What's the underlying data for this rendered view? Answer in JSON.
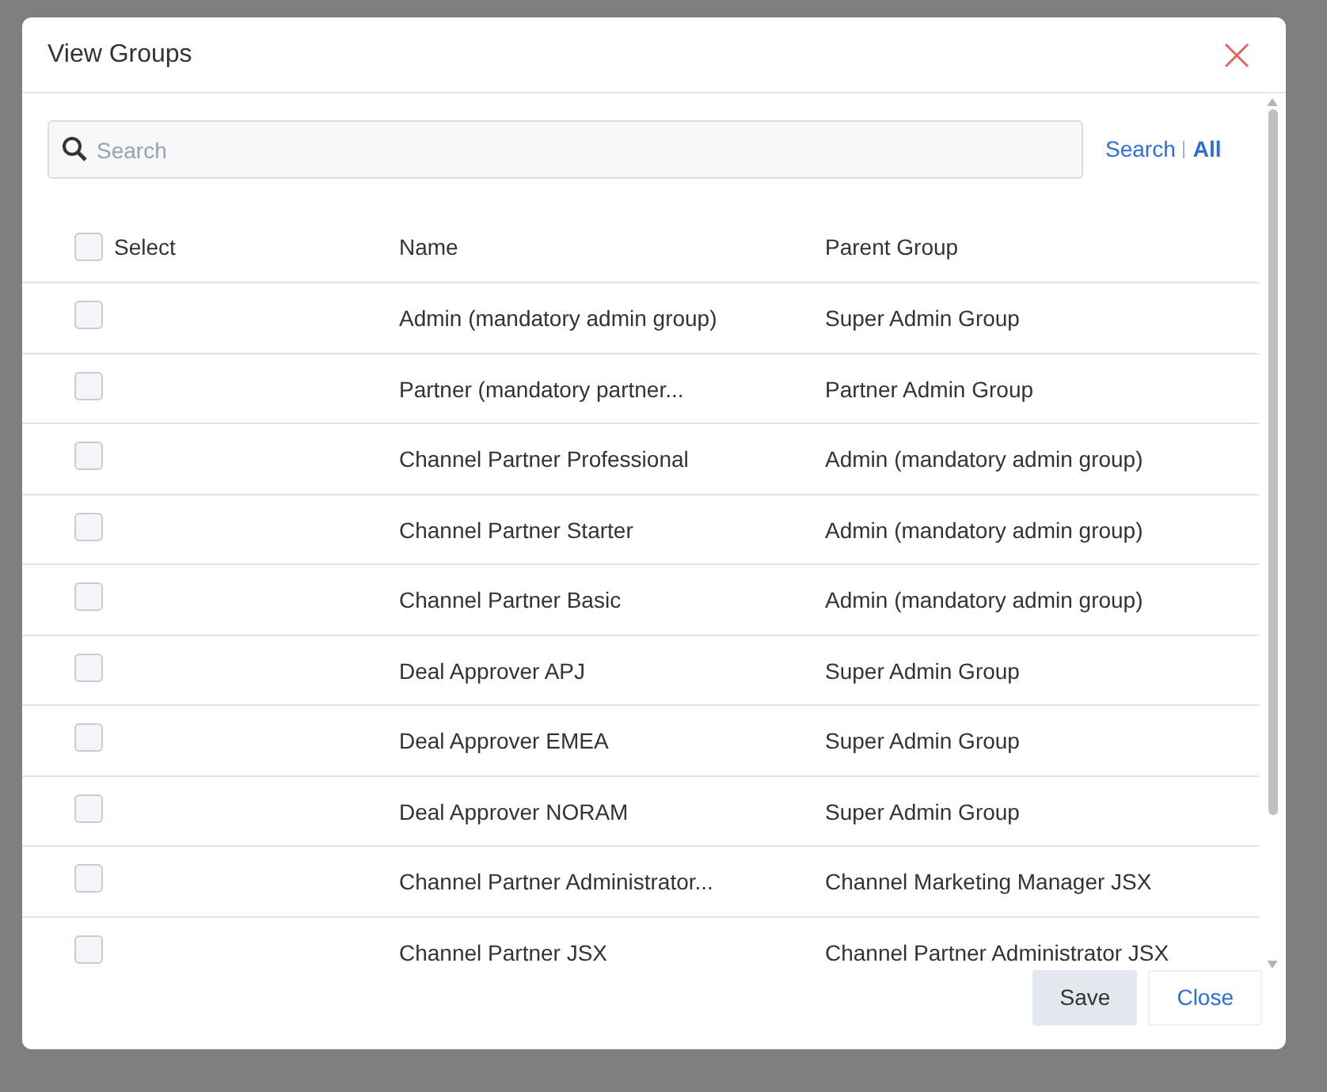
{
  "dialog": {
    "title": "View Groups"
  },
  "search": {
    "placeholder": "Search",
    "links": [
      "Search",
      "All"
    ]
  },
  "table": {
    "select_all": {
      "label": "Select",
      "checked": false
    },
    "columns": [
      "Name",
      "Parent Group"
    ],
    "rows": [
      {
        "name": "Admin (mandatory admin group)",
        "parent_group": "Super Admin Group",
        "checked": false
      },
      {
        "name": "Partner (mandatory partner...",
        "parent_group": "Partner Admin Group",
        "checked": false
      },
      {
        "name": "Channel Partner Professional",
        "parent_group": "Admin (mandatory admin group)",
        "checked": false
      },
      {
        "name": "Channel Partner Starter",
        "parent_group": "Admin (mandatory admin group)",
        "checked": false
      },
      {
        "name": "Channel Partner Basic",
        "parent_group": "Admin (mandatory admin group)",
        "checked": false
      },
      {
        "name": "Deal Approver APJ",
        "parent_group": "Super Admin Group",
        "checked": false
      },
      {
        "name": "Deal Approver EMEA",
        "parent_group": "Super Admin Group",
        "checked": false
      },
      {
        "name": "Deal Approver NORAM",
        "parent_group": "Super Admin Group",
        "checked": false
      },
      {
        "name": "Channel Partner Administrator...",
        "parent_group": "Channel Marketing Manager JSX",
        "checked": false
      },
      {
        "name": "Channel Partner JSX",
        "parent_group": "Channel Partner Administrator JSX",
        "checked": false
      }
    ]
  },
  "buttons": [
    {
      "label": "Save",
      "kind": "primary"
    },
    {
      "label": "Close",
      "kind": "link"
    }
  ]
}
